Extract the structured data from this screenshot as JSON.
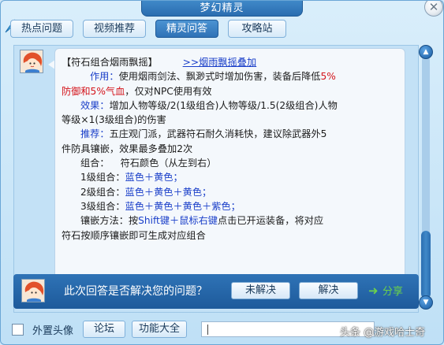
{
  "window": {
    "title": "梦幻精灵"
  },
  "tabs": [
    {
      "label": "热点问题"
    },
    {
      "label": "视频推荐"
    },
    {
      "label": "精灵问答"
    },
    {
      "label": "攻略站"
    }
  ],
  "answer": {
    "header": "【符石组合烟雨飘摇】",
    "link": ">>烟雨飘摇叠加",
    "effect_label": "作用：",
    "effect_text_a": "使用烟雨剑法、飘渺式时增加伤害，装备后降低",
    "effect_red_a": "5%",
    "effect_red_b": "防御和5%气血",
    "effect_text_b": "，仅对NPC使用有效",
    "result_label": "效果：",
    "result_text_a": "增加人物等级/2(1级组合)人物等级/1.5(2级组合)人物",
    "result_text_b": "等级×1(3级组合)的伤害",
    "recommend_label": "推荐：",
    "recommend_text_a": "五庄观门派，武器符石耐久消耗快，建议除武器外5",
    "recommend_text_b": "件防具镶嵌，效果最多叠加2次",
    "combo_label": "组合：",
    "combo_order": "符石颜色（从左到右）",
    "lvl1_label": "1级组合：",
    "lvl1_value": "蓝色＋黄色；",
    "lvl2_label": "2级组合：",
    "lvl2_value": "蓝色＋黄色＋黄色；",
    "lvl3_label": "3级组合：",
    "lvl3_value": "蓝色＋黄色＋黄色＋紫色；",
    "method_label": "镶嵌方法：",
    "method_text_a": "按",
    "method_key": "Shift键＋鼠标右键",
    "method_text_b": "点击已开运装备，将对应",
    "method_text_c": "符石按顺序镶嵌即可生成对应组合"
  },
  "feedback": {
    "question": "此次回答是否解决您的问题？",
    "unresolved": "未解决",
    "resolved": "解决",
    "share": "分享"
  },
  "bottom": {
    "checkbox_label": "外置头像",
    "forum": "论坛",
    "features": "功能大全",
    "watermark": "头条 @游戏哈士奇"
  },
  "colors": {
    "accent": "#2f72b6",
    "highlight_blue": "#1a3fc9",
    "highlight_red": "#d4141b",
    "share_green": "#6cd34a"
  },
  "icons": {
    "close": "close-icon",
    "scroll_up": "arrow-up-icon",
    "scroll_down": "arrow-down-icon",
    "share": "share-arrow-icon"
  }
}
